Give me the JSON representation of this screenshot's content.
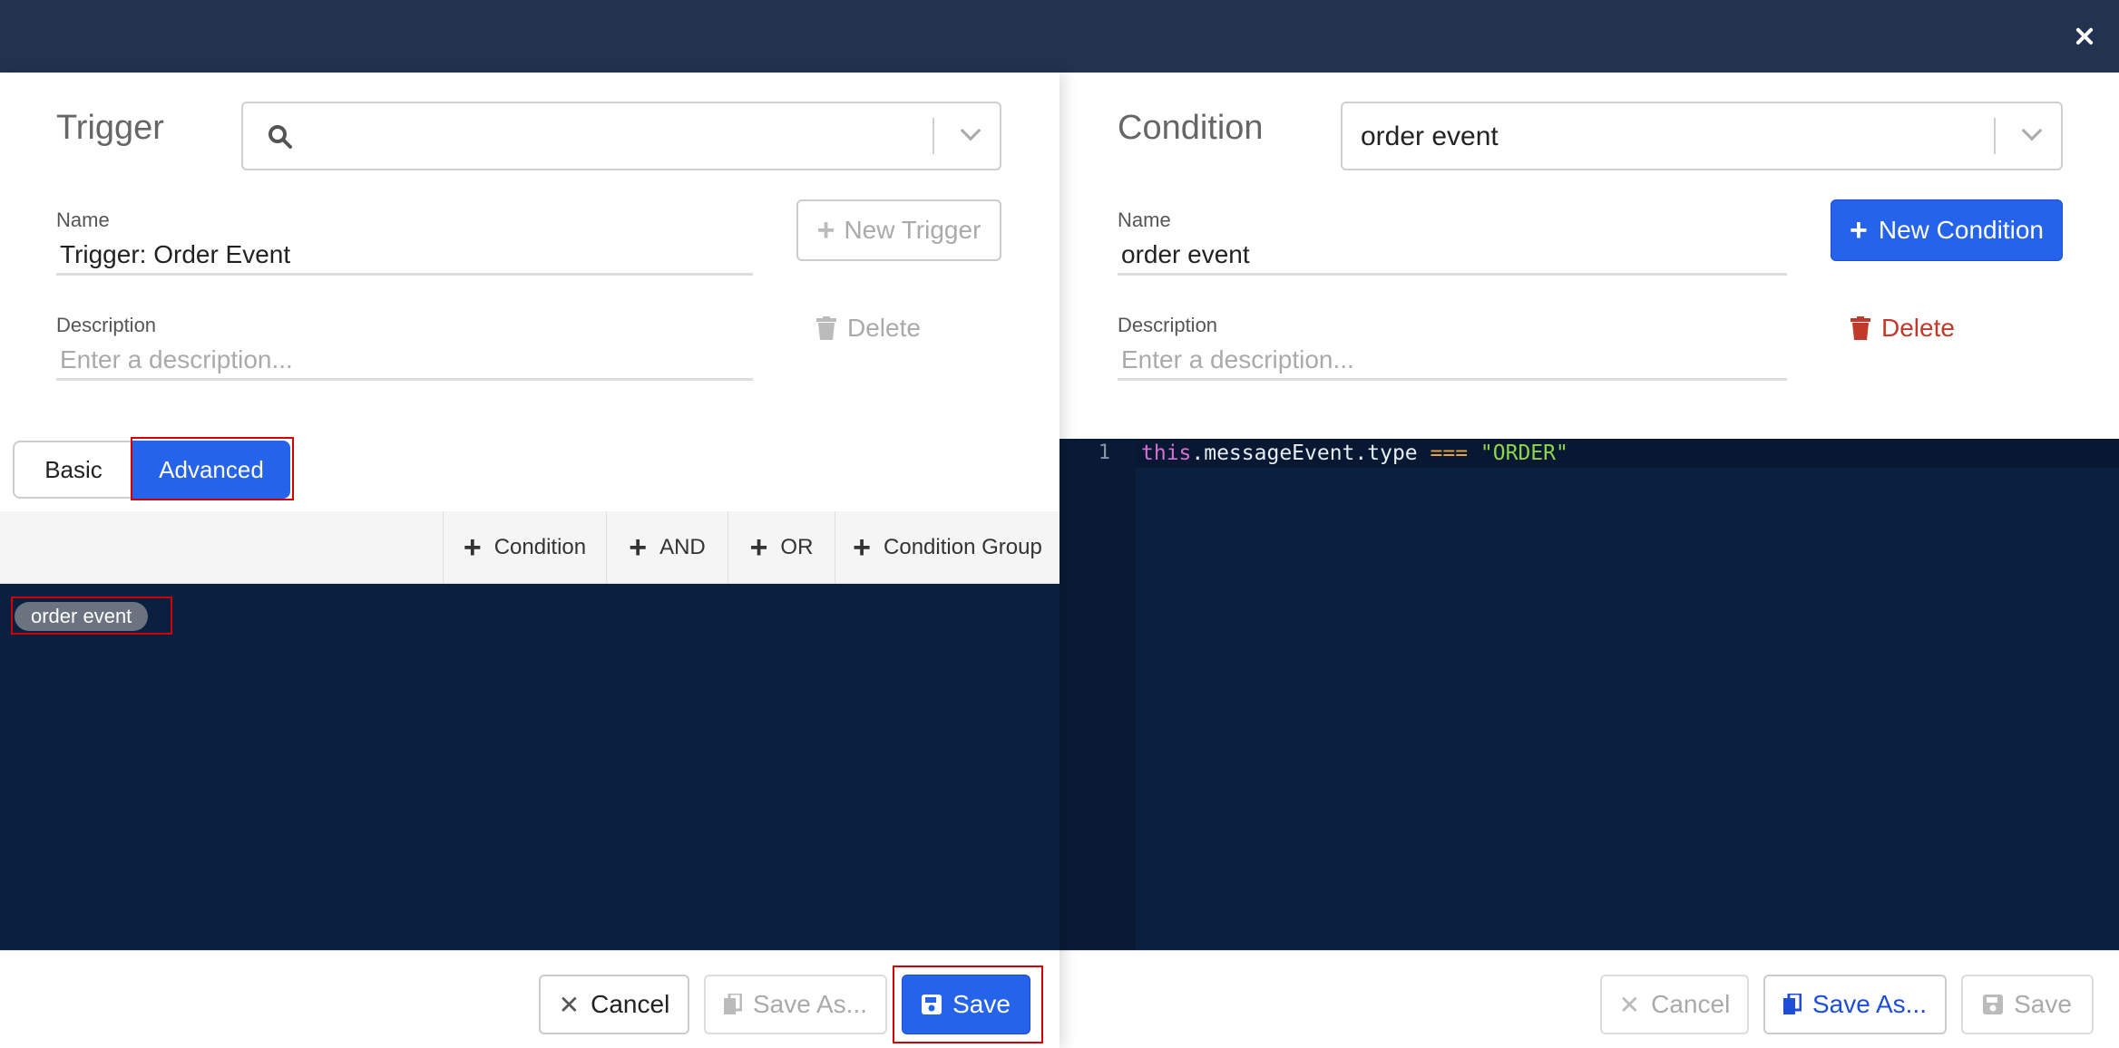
{
  "left": {
    "heading": "Trigger",
    "search": {
      "value": ""
    },
    "name": {
      "label": "Name",
      "value": "Trigger: Order Event"
    },
    "description": {
      "label": "Description",
      "placeholder": "Enter a description..."
    },
    "new_button": "New Trigger",
    "delete_button": "Delete",
    "tabs": {
      "basic": "Basic",
      "advanced": "Advanced"
    },
    "toolbar": {
      "condition": "Condition",
      "and": "AND",
      "or": "OR",
      "group": "Condition Group"
    },
    "chip": "order event",
    "footer": {
      "cancel": "Cancel",
      "save_as": "Save As...",
      "save": "Save"
    }
  },
  "right": {
    "heading": "Condition",
    "select_value": "order event",
    "name": {
      "label": "Name",
      "value": "order event"
    },
    "description": {
      "label": "Description",
      "placeholder": "Enter a description..."
    },
    "new_button": "New Condition",
    "delete_button": "Delete",
    "editor": {
      "line_number": "1",
      "tok_this": "this",
      "tok_prop": ".messageEvent.type ",
      "tok_op": "===",
      "tok_space": " ",
      "tok_str": "\"ORDER\""
    },
    "footer": {
      "cancel": "Cancel",
      "save_as": "Save As...",
      "save": "Save"
    }
  },
  "colors": {
    "topbar": "#22324f",
    "primary": "#2563eb",
    "danger": "#c0392b",
    "editor_bg": "#0b1f3f"
  }
}
